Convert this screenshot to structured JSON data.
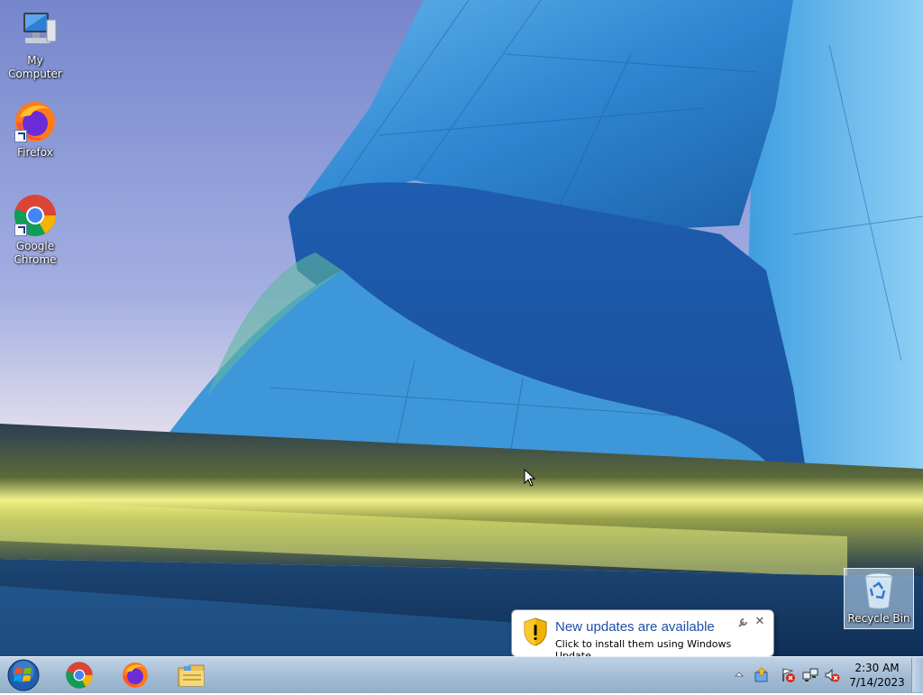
{
  "desktop": {
    "icons": [
      {
        "label": "My Computer"
      },
      {
        "label": "Firefox"
      },
      {
        "label": "Google Chrome"
      },
      {
        "label": "Recycle Bin"
      }
    ]
  },
  "notification": {
    "title": "New updates are available",
    "text": "Click to install them using Windows Update.",
    "close_glyph": "✕",
    "icon": "shield-warning-icon"
  },
  "taskbar": {
    "pinned": [
      {
        "name": "Google Chrome",
        "icon": "chrome-icon"
      },
      {
        "name": "Firefox",
        "icon": "firefox-icon"
      },
      {
        "name": "Windows Explorer",
        "icon": "folder-icon"
      }
    ],
    "tray_icons": [
      "windows-update-icon",
      "action-center-icon",
      "network-icon",
      "volume-muted-icon"
    ],
    "clock": {
      "time": "2:30 AM",
      "date": "7/14/2023"
    }
  },
  "colors": {
    "balloon_title": "#1e4fa8",
    "taskbar": "#a0b9d2"
  }
}
